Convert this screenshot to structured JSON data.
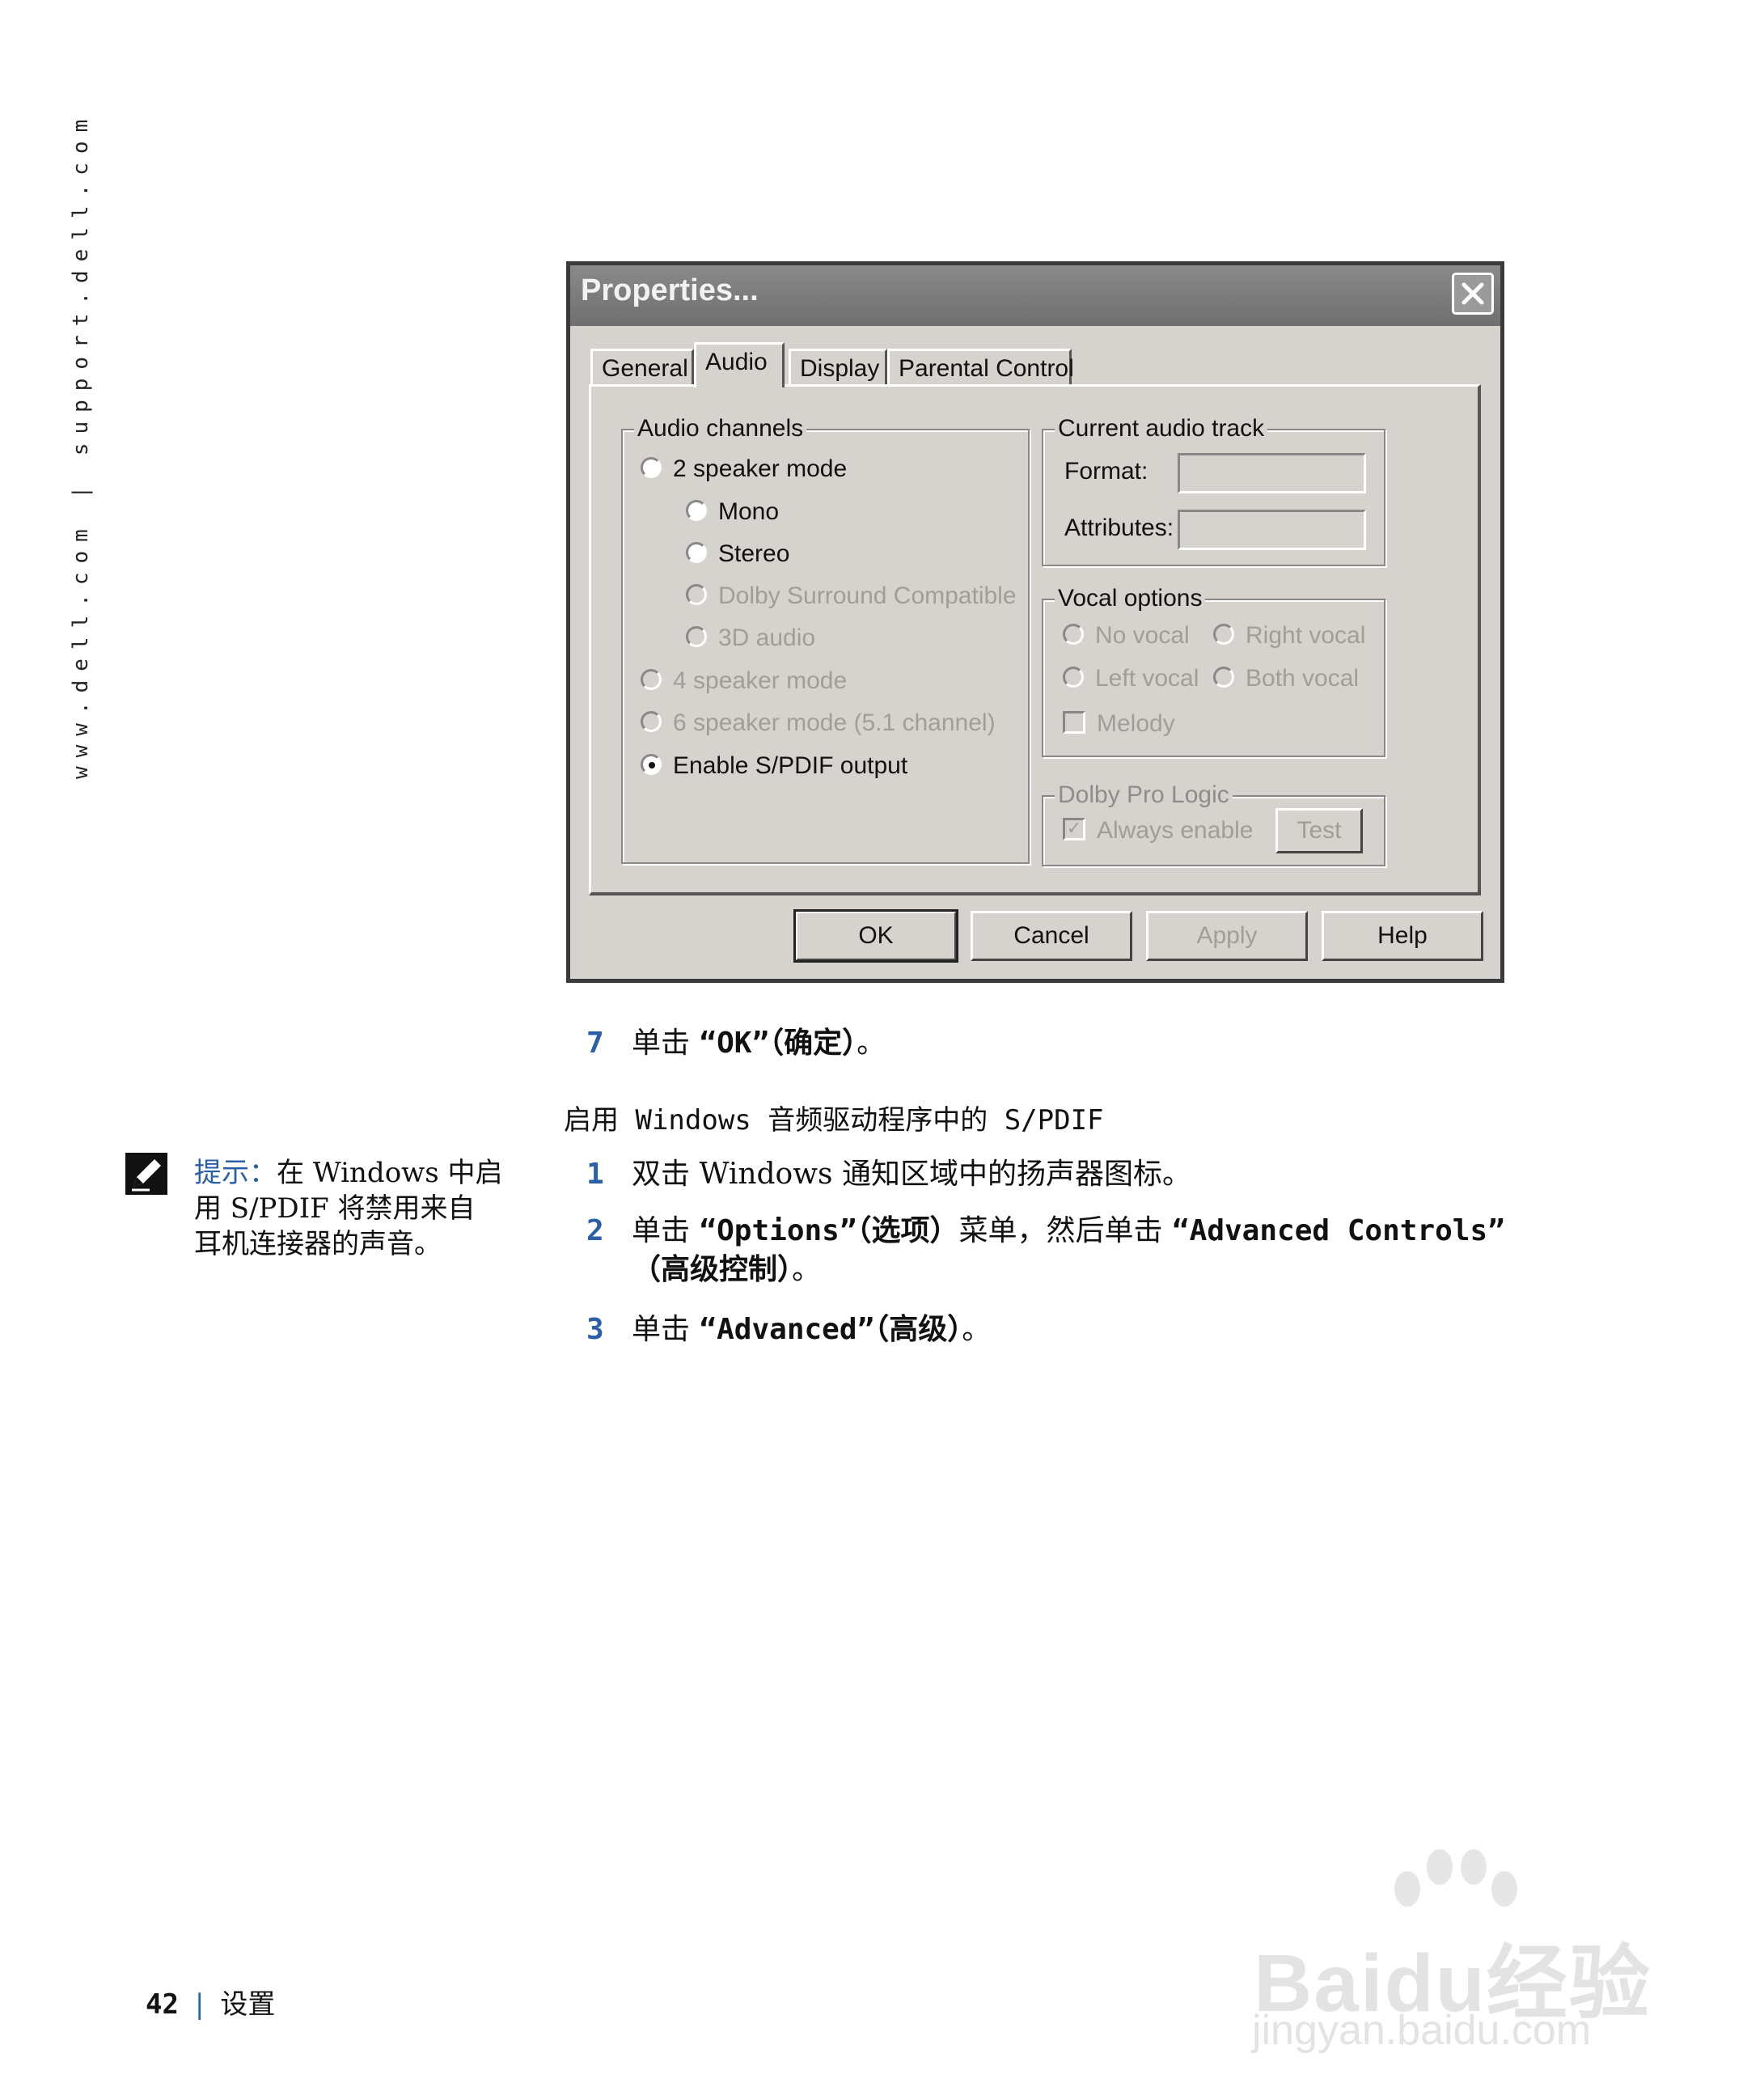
{
  "side_url": "www.dell.com | support.dell.com",
  "dialog": {
    "title": "Properties...",
    "tabs": [
      "General",
      "Audio",
      "Display",
      "Parental Control"
    ],
    "active_tab": "Audio",
    "audio_channels": {
      "label": "Audio channels",
      "options": [
        {
          "label": "2 speaker mode",
          "checked": false,
          "enabled": true
        },
        {
          "label": "Mono",
          "checked": false,
          "enabled": true
        },
        {
          "label": "Stereo",
          "checked": false,
          "enabled": true
        },
        {
          "label": "Dolby Surround Compatible",
          "checked": false,
          "enabled": false
        },
        {
          "label": "3D audio",
          "checked": false,
          "enabled": false
        },
        {
          "label": "4 speaker mode",
          "checked": false,
          "enabled": false
        },
        {
          "label": "6 speaker mode (5.1 channel)",
          "checked": false,
          "enabled": false
        },
        {
          "label": "Enable S/PDIF output",
          "checked": true,
          "enabled": true
        }
      ]
    },
    "current_audio_track": {
      "label": "Current audio track",
      "format_label": "Format:",
      "format_value": "",
      "attributes_label": "Attributes:",
      "attributes_value": ""
    },
    "vocal_options": {
      "label": "Vocal options",
      "no_vocal": "No vocal",
      "right_vocal": "Right vocal",
      "left_vocal": "Left vocal",
      "both_vocal": "Both vocal",
      "melody": "Melody"
    },
    "dolby_pro_logic": {
      "label": "Dolby Pro Logic",
      "always_enable": "Always enable",
      "test_button": "Test"
    },
    "buttons": {
      "ok": "OK",
      "cancel": "Cancel",
      "apply": "Apply",
      "help": "Help"
    }
  },
  "steps_a": [
    {
      "num": "7",
      "pre": "单击 ",
      "bold": "“OK”（确定）",
      "post": "。"
    }
  ],
  "section_heading": "启用 Windows 音频驱动程序中的 S/PDIF",
  "note": {
    "label": "提示：",
    "line1": "在 Windows 中启",
    "line2": "用 S/PDIF 将禁用来自",
    "line3": "耳机连接器的声音。"
  },
  "steps_b": {
    "s1": {
      "num": "1",
      "text": "双击 Windows 通知区域中的扬声器图标。"
    },
    "s2": {
      "num": "2",
      "pre": "单击 ",
      "bold1": "“Options”（选项）",
      "mid": "菜单，然后单击 ",
      "bold2": "“Advanced Controls”",
      "cont": "（高级控制）",
      "post": "。"
    },
    "s3": {
      "num": "3",
      "pre": "单击 ",
      "bold": "“Advanced”（高级）",
      "post": "。"
    }
  },
  "footer": {
    "page": "42",
    "separator": "|",
    "section": "设置"
  },
  "watermark": {
    "text": "Baidu经验",
    "sub": "jingyan.baidu.com"
  }
}
